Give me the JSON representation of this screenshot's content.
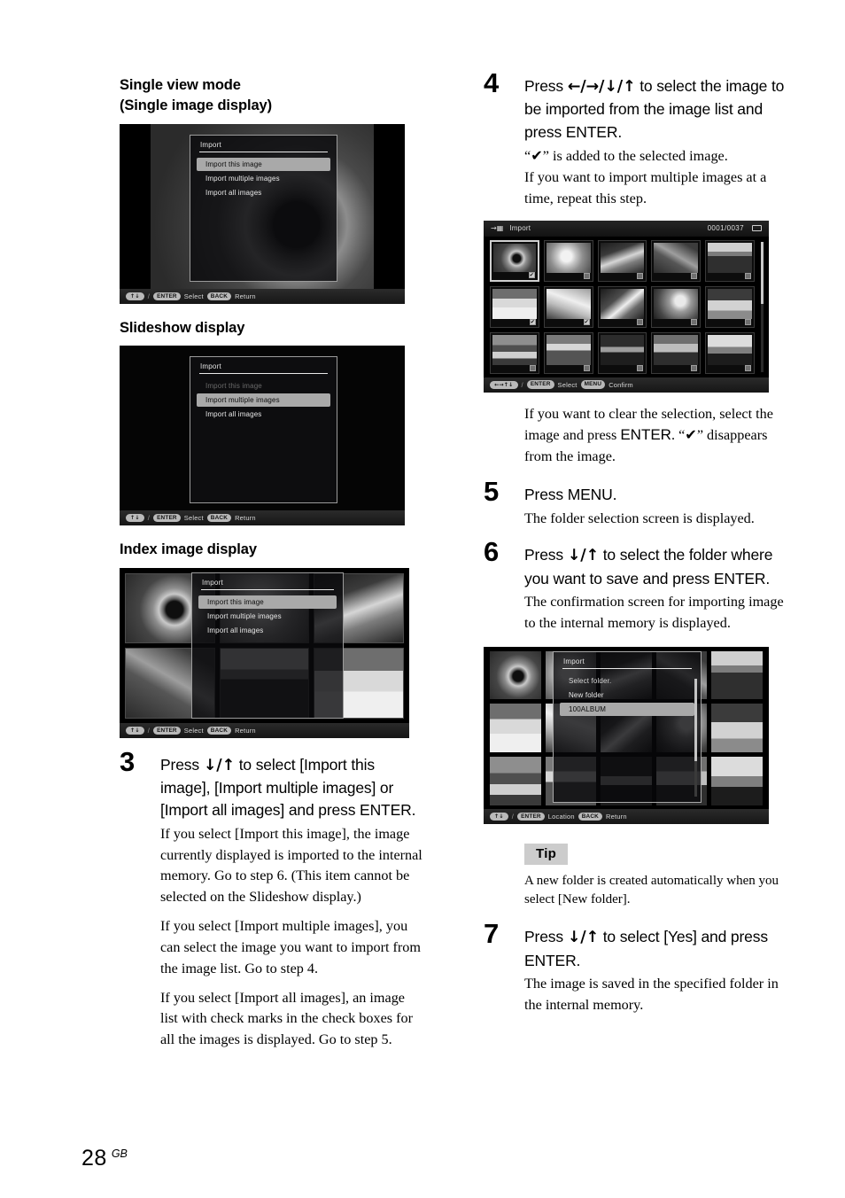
{
  "page": {
    "number": "28",
    "locale": "GB"
  },
  "left": {
    "heading_single": "Single view mode\n(Single image display)",
    "heading_single_line1": "Single view mode",
    "heading_single_line2": "(Single image display)",
    "heading_slideshow": "Slideshow display",
    "heading_index": "Index image display",
    "shot_single": {
      "menu_title": "Import",
      "items": [
        {
          "label": "Import this image",
          "state": "selected"
        },
        {
          "label": "Import multiple images",
          "state": "normal"
        },
        {
          "label": "Import all images",
          "state": "normal"
        }
      ],
      "osd": {
        "arrows": "↑↓",
        "slash": "/",
        "enter": "ENTER",
        "enter_action": "Select",
        "back": "BACK",
        "back_action": "Return"
      }
    },
    "shot_slideshow": {
      "menu_title": "Import",
      "items": [
        {
          "label": "Import this image",
          "state": "disabled"
        },
        {
          "label": "Import multiple images",
          "state": "selected"
        },
        {
          "label": "Import all images",
          "state": "normal"
        }
      ],
      "osd": {
        "arrows": "↑↓",
        "slash": "/",
        "enter": "ENTER",
        "enter_action": "Select",
        "back": "BACK",
        "back_action": "Return"
      }
    },
    "shot_index": {
      "menu_title": "Import",
      "items": [
        {
          "label": "Import this image",
          "state": "selected"
        },
        {
          "label": "Import multiple images",
          "state": "normal"
        },
        {
          "label": "Import all images",
          "state": "normal"
        }
      ],
      "osd": {
        "arrows": "↑↓",
        "slash": "/",
        "enter": "ENTER",
        "enter_action": "Select",
        "back": "BACK",
        "back_action": "Return"
      }
    },
    "step3": {
      "number": "3",
      "title_a": "Press ",
      "title_arrows": "↓/↑",
      "title_b": " to select [Import this image], [Import multiple images] or [Import all images] and press ENTER.",
      "para1": "If you select [Import this image], the image currently displayed is imported to the internal memory. Go to step 6. (This item cannot be selected on the Slideshow display.)",
      "para2": "If you select [Import multiple images], you can select the image you want to import from the image list. Go to step 4.",
      "para3": "If you select [Import all images], an image list with check marks in the check boxes for all the images is displayed. Go to step 5."
    }
  },
  "right": {
    "step4": {
      "number": "4",
      "title_a": "Press ",
      "title_arrows": "←/→/↓/↑",
      "title_b": " to select the image to be imported from the image list and press ENTER.",
      "para1_pre": "“",
      "para1_check": "✔",
      "para1_post": "” is added to the selected image.",
      "para2": "If you want to import multiple images at a time, repeat this step."
    },
    "shot_list": {
      "title": "Import",
      "counter": "0001/0037",
      "osd": {
        "arrows": "←→↑↓",
        "slash": "/",
        "enter": "ENTER",
        "enter_action": "Select",
        "menu": "MENU",
        "menu_action": "Confirm"
      },
      "tiles": [
        {
          "photo": "sun",
          "checked": true,
          "current": true
        },
        {
          "photo": "lily",
          "checked": false,
          "current": false
        },
        {
          "photo": "coral",
          "checked": false,
          "current": false
        },
        {
          "photo": "fish",
          "checked": false,
          "current": false
        },
        {
          "photo": "beachhut",
          "checked": false,
          "current": false
        },
        {
          "photo": "sea",
          "checked": true,
          "current": false
        },
        {
          "photo": "shore",
          "checked": true,
          "current": false
        },
        {
          "photo": "cart",
          "checked": false,
          "current": false
        },
        {
          "photo": "flwr",
          "checked": false,
          "current": false
        },
        {
          "photo": "pots",
          "checked": false,
          "current": false
        },
        {
          "photo": "lake",
          "checked": false,
          "current": false
        },
        {
          "photo": "field",
          "checked": false,
          "current": false
        },
        {
          "photo": "road",
          "checked": false,
          "current": false
        },
        {
          "photo": "mtn",
          "checked": false,
          "current": false
        },
        {
          "photo": "city",
          "checked": false,
          "current": false
        }
      ]
    },
    "after_step4": {
      "line_a": "If you want to clear the selection, select the image and press ",
      "enter": "ENTER",
      "line_b": ". “",
      "check": "✔",
      "line_c": "” disappears from the image."
    },
    "step5": {
      "number": "5",
      "title": "Press MENU.",
      "para": "The folder selection screen is displayed."
    },
    "step6": {
      "number": "6",
      "title_a": "Press ",
      "title_arrows": "↓/↑",
      "title_b": " to select the folder where you want to save and press ENTER.",
      "para": "The confirmation screen for importing image to the internal memory is displayed."
    },
    "shot_folder": {
      "dialog_title": "Import",
      "items": [
        {
          "label": "Select folder.",
          "state": "label"
        },
        {
          "label": "New folder",
          "state": "normal"
        },
        {
          "label": "100ALBUM",
          "state": "selected"
        }
      ],
      "osd": {
        "arrows": "↑↓",
        "slash": "/",
        "enter": "ENTER",
        "enter_action": "Location",
        "back": "BACK",
        "back_action": "Return"
      },
      "photos": [
        "sun",
        "lily",
        "coral",
        "fish",
        "beachhut",
        "sea",
        "shore",
        "cart",
        "flwr",
        "pots",
        "lake",
        "field",
        "road",
        "mtn",
        "city"
      ]
    },
    "tip": {
      "badge": "Tip",
      "text": "A new folder is created automatically when you select [New folder]."
    },
    "step7": {
      "number": "7",
      "title_a": "Press ",
      "title_arrows": "↓/↑",
      "title_b": " to select [Yes] and press ENTER.",
      "para": "The image is saved in the specified folder in the internal memory."
    }
  },
  "colors": {
    "tip_badge_bg": "#cccccc",
    "osd_pill_bg": "#b9b9b9",
    "menu_selected_bg": "#a9a9a9",
    "page_bg": "#ffffff"
  }
}
